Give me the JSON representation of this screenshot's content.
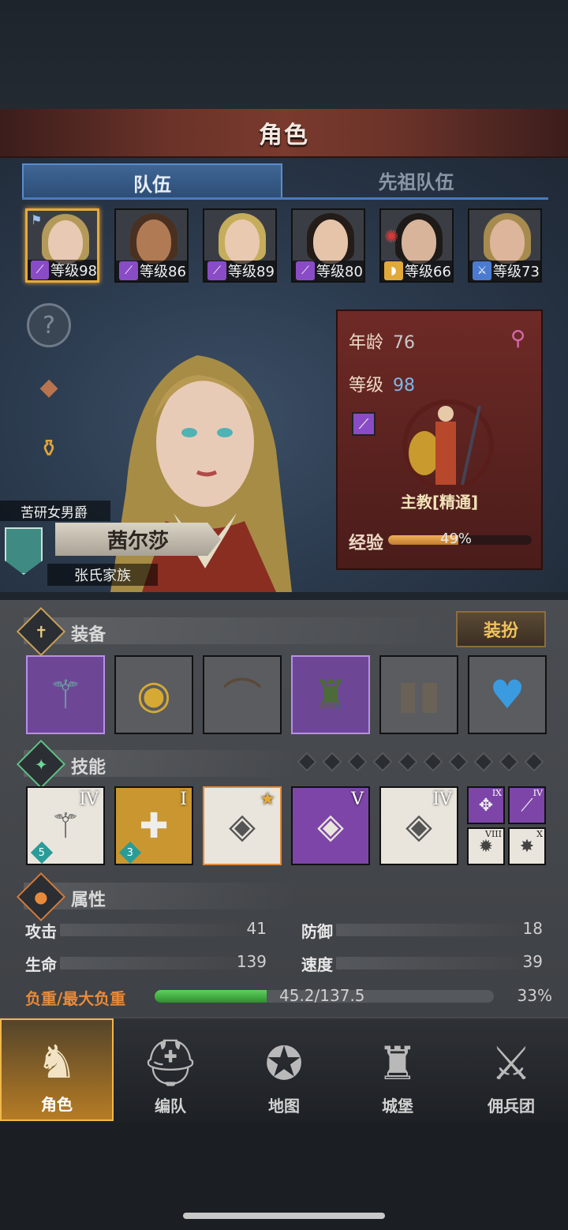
{
  "header": {
    "title": "角色"
  },
  "tabs": [
    {
      "label": "队伍"
    },
    {
      "label": "先祖队伍"
    }
  ],
  "roster": [
    {
      "level_label": "等级98",
      "class_color": "#8a4cc6",
      "class_icon": "staff"
    },
    {
      "level_label": "等级86",
      "class_color": "#8a4cc6",
      "class_icon": "staff"
    },
    {
      "level_label": "等级89",
      "class_color": "#8a4cc6",
      "class_icon": "staff"
    },
    {
      "level_label": "等级80",
      "class_color": "#8a4cc6",
      "class_icon": "staff"
    },
    {
      "level_label": "等级66",
      "class_color": "#e0a93a",
      "class_icon": "shield"
    },
    {
      "level_label": "等级73",
      "class_color": "#4a7bd0",
      "class_icon": "sword"
    }
  ],
  "character": {
    "title": "苦研女男爵",
    "name": "茜尔莎",
    "family": "张氏家族"
  },
  "info": {
    "age_label": "年龄",
    "age": "76",
    "level_label": "等级",
    "level": "98",
    "class_name": "主教[精通]",
    "exp_label": "经验",
    "exp_percent": "49%",
    "exp_fraction": 0.49
  },
  "equipment": {
    "title": "装备",
    "dress_button": "装扮",
    "items": [
      {
        "icon": "mace-icon",
        "rarity": "purple"
      },
      {
        "icon": "round-shield-icon",
        "rarity": "grey"
      },
      {
        "icon": "hood-icon",
        "rarity": "grey"
      },
      {
        "icon": "fur-armor-icon",
        "rarity": "purple"
      },
      {
        "icon": "boots-icon",
        "rarity": "grey"
      },
      {
        "icon": "heart-amulet-icon",
        "rarity": "grey"
      }
    ]
  },
  "skills": {
    "title": "技能",
    "slots": 10,
    "items": [
      {
        "rank": "IV",
        "count": "5",
        "color": "#e9e5dc"
      },
      {
        "rank": "I",
        "count": "3",
        "color": "#c9962f"
      },
      {
        "rank": "",
        "count": "",
        "color": "#e9e5dc"
      },
      {
        "rank": "V",
        "count": "",
        "color": "#7d45a8"
      },
      {
        "rank": "IV",
        "count": "",
        "color": "#e9e5dc"
      }
    ],
    "minis": [
      {
        "rank": "IX",
        "color": "#7d45a8"
      },
      {
        "rank": "IV",
        "color": "#7d45a8"
      },
      {
        "rank": "VIII",
        "color": "#e9e5dc"
      },
      {
        "rank": "X",
        "color": "#e9e5dc"
      }
    ]
  },
  "attributes": {
    "title": "属性",
    "attack_label": "攻击",
    "attack": "41",
    "defense_label": "防御",
    "defense": "18",
    "hp_label": "生命",
    "hp": "139",
    "speed_label": "速度",
    "speed": "39",
    "load_label": "负重/最大负重",
    "load_value": "45.2/137.5",
    "load_percent": "33%",
    "load_fraction": 0.33
  },
  "nav": [
    {
      "label": "角色"
    },
    {
      "label": "编队"
    },
    {
      "label": "地图"
    },
    {
      "label": "城堡"
    },
    {
      "label": "佣兵团"
    }
  ],
  "colors": {
    "accent": "#e8a93a",
    "tab_blue": "#4a7bbd",
    "exp_fill": "#d89440",
    "load_fill": "#3cae3c"
  }
}
